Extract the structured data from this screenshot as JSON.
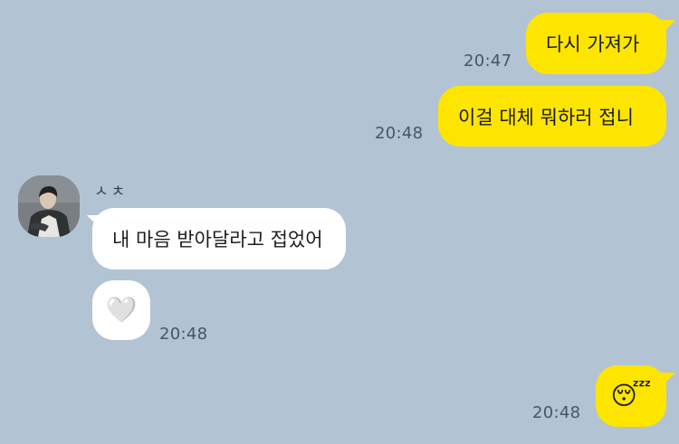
{
  "chat": {
    "background_color": "#B2C3D4",
    "my_bubble_color": "#FEE500",
    "their_bubble_color": "#FFFFFF",
    "messages": [
      {
        "sender": "me",
        "text": "다시 가져가",
        "time": "20:47"
      },
      {
        "sender": "me",
        "text": "이걸 대체 뭐하러 접니",
        "time": "20:48"
      },
      {
        "sender": "them",
        "text": "내 마음 받아달라고 접었어"
      },
      {
        "sender": "them",
        "text": "🤍",
        "icon": "white-heart-emoji",
        "time": "20:48"
      },
      {
        "sender": "me",
        "text": "😴",
        "icon": "sleeping-face-emoji",
        "time": "20:48"
      }
    ],
    "contact": {
      "name": "ㅅㅊ",
      "avatar": "profile-photo"
    }
  }
}
